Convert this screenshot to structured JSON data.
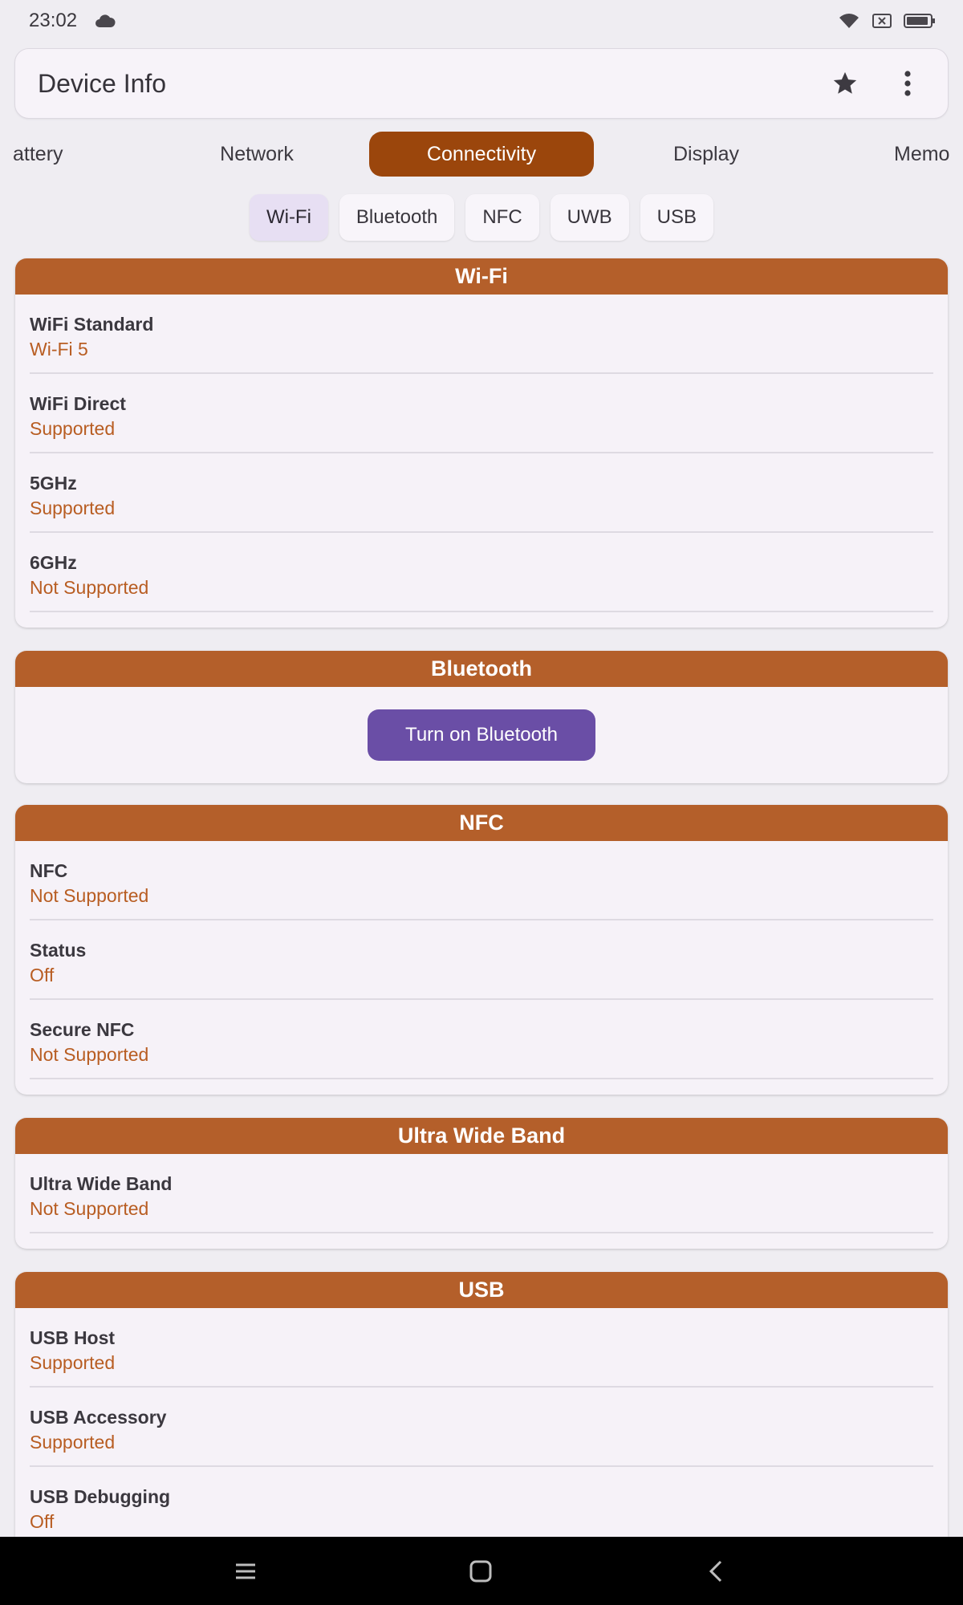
{
  "status_bar": {
    "time": "23:02",
    "icons": [
      "cloud-icon",
      "wifi-icon",
      "sim-off-icon",
      "battery-icon"
    ]
  },
  "app_bar": {
    "title": "Device Info",
    "actions": [
      "star-icon",
      "more-vert-icon"
    ]
  },
  "tabs": [
    {
      "label": "attery"
    },
    {
      "label": "Network"
    },
    {
      "label": "Connectivity",
      "active": true
    },
    {
      "label": "Display"
    },
    {
      "label": "Memo"
    }
  ],
  "chips": [
    {
      "label": "Wi-Fi",
      "selected": true
    },
    {
      "label": "Bluetooth"
    },
    {
      "label": "NFC"
    },
    {
      "label": "UWB"
    },
    {
      "label": "USB"
    }
  ],
  "sections": {
    "wifi": {
      "title": "Wi-Fi",
      "rows": [
        {
          "label": "WiFi Standard",
          "value": "Wi-Fi 5"
        },
        {
          "label": "WiFi Direct",
          "value": "Supported"
        },
        {
          "label": "5GHz",
          "value": "Supported"
        },
        {
          "label": "6GHz",
          "value": "Not Supported"
        }
      ]
    },
    "bluetooth": {
      "title": "Bluetooth",
      "button_label": "Turn on Bluetooth"
    },
    "nfc": {
      "title": "NFC",
      "rows": [
        {
          "label": "NFC",
          "value": "Not Supported"
        },
        {
          "label": "Status",
          "value": "Off"
        },
        {
          "label": "Secure NFC",
          "value": "Not Supported"
        }
      ]
    },
    "uwb": {
      "title": "Ultra Wide Band",
      "rows": [
        {
          "label": "Ultra Wide Band",
          "value": "Not Supported"
        }
      ]
    },
    "usb": {
      "title": "USB",
      "rows": [
        {
          "label": "USB Host",
          "value": "Supported"
        },
        {
          "label": "USB Accessory",
          "value": "Supported"
        },
        {
          "label": "USB Debugging",
          "value": "Off"
        }
      ]
    }
  },
  "nav_bar": {
    "buttons": [
      "recents-icon",
      "home-icon",
      "back-icon"
    ]
  },
  "colors": {
    "accent_tab": "#9b460c",
    "section_header": "#b45f2a",
    "value_text": "#b85d22",
    "button": "#6a4ea6",
    "chip_selected": "#e7dff3"
  }
}
